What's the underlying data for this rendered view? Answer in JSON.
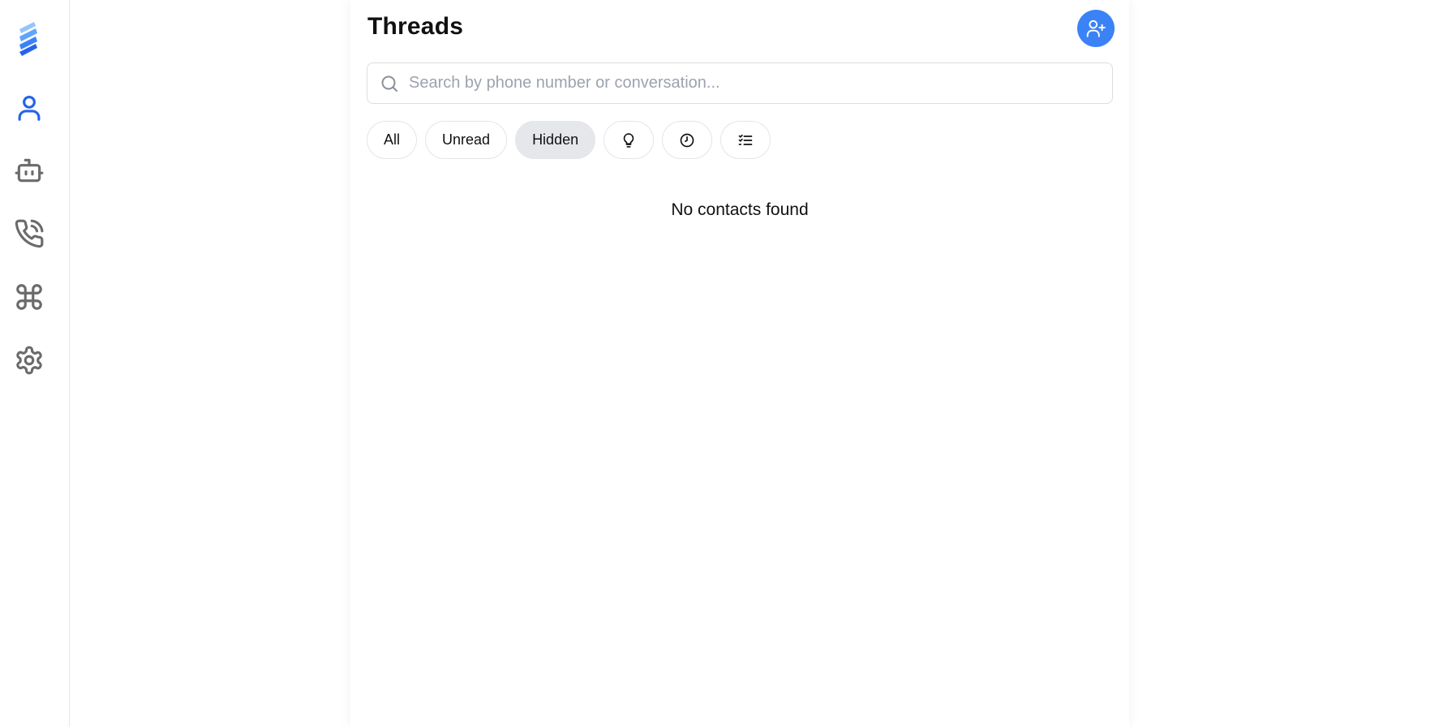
{
  "sidebar": {
    "logo_icon": "stacked-bars-logo",
    "items": [
      {
        "name": "contacts",
        "icon": "user-icon",
        "active": true
      },
      {
        "name": "bot",
        "icon": "bot-icon",
        "active": false
      },
      {
        "name": "calls",
        "icon": "phone-call-icon",
        "active": false
      },
      {
        "name": "commands",
        "icon": "command-icon",
        "active": false
      },
      {
        "name": "settings",
        "icon": "gear-icon",
        "active": false
      }
    ],
    "active_color": "#2563eb",
    "inactive_color": "#6b6b6b"
  },
  "main": {
    "title": "Threads",
    "add_contact_icon": "user-plus-icon",
    "accent_color": "#3b82f6",
    "search": {
      "placeholder": "Search by phone number or conversation...",
      "value": ""
    },
    "filters": [
      {
        "label": "All",
        "active": false
      },
      {
        "label": "Unread",
        "active": false
      },
      {
        "label": "Hidden",
        "active": true
      }
    ],
    "icon_filters": [
      "lightbulb-icon",
      "clock-icon",
      "checklist-icon"
    ],
    "empty_message": "No contacts found"
  }
}
